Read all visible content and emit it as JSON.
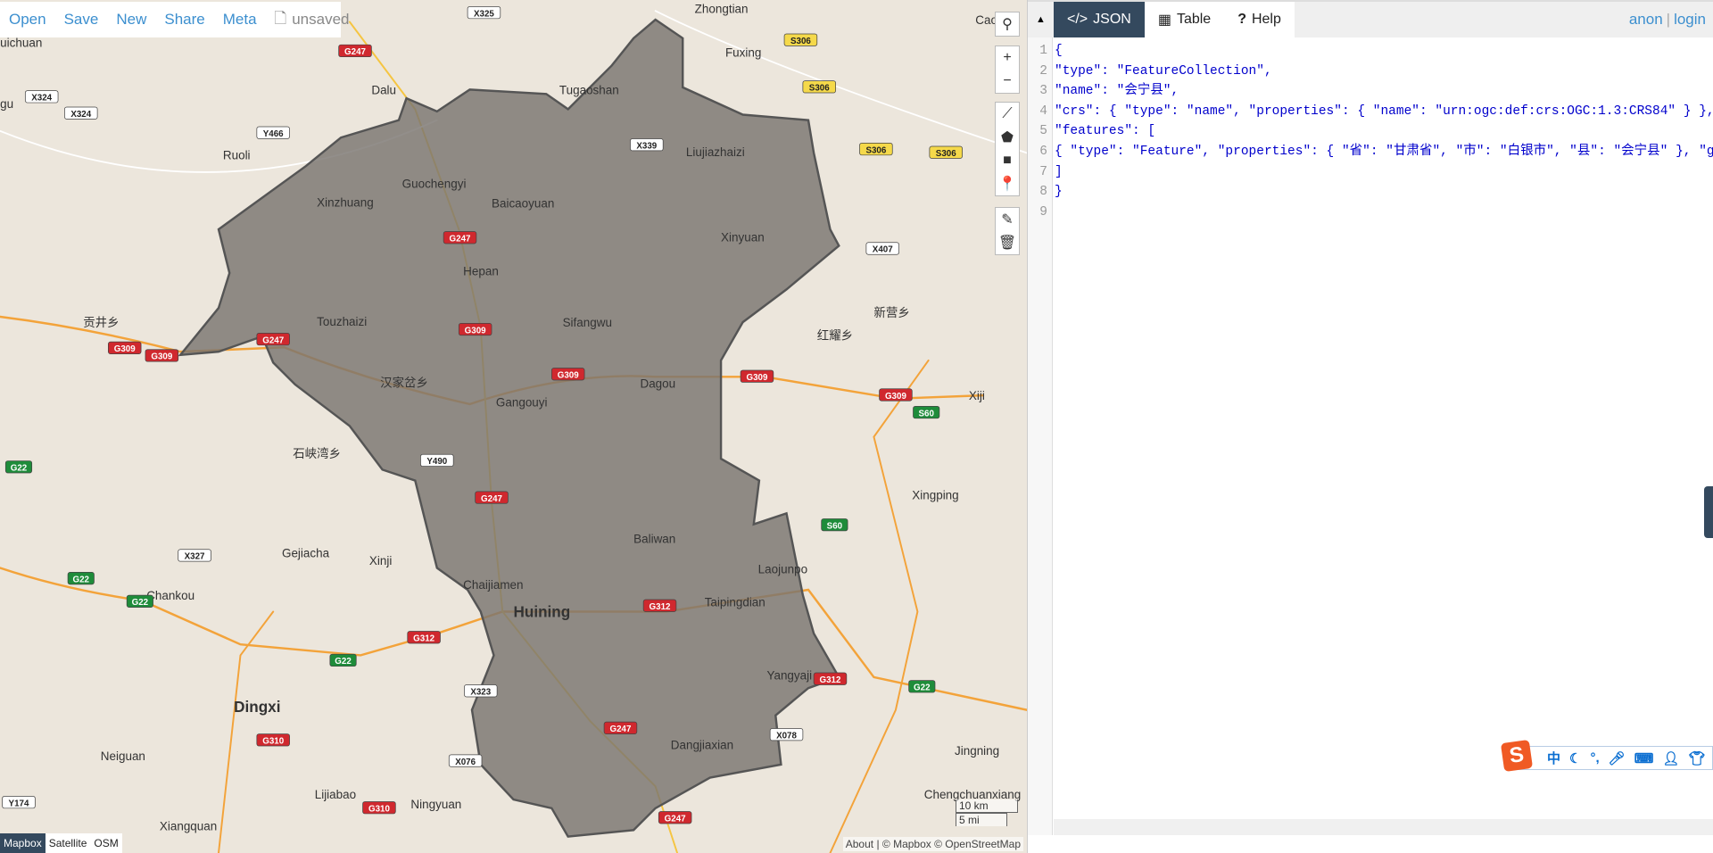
{
  "topbar": {
    "open": "Open",
    "save": "Save",
    "new": "New",
    "share": "Share",
    "meta": "Meta",
    "status": "unsaved"
  },
  "map": {
    "controls": [
      "search-icon",
      "zoom-in",
      "zoom-out",
      "draw-line-icon",
      "draw-polygon-icon",
      "draw-rectangle-icon",
      "draw-marker-icon",
      "edit-icon",
      "delete-icon"
    ],
    "zoom_in": "+",
    "zoom_out": "−",
    "places": [
      "Zhongtian",
      "Fuxing",
      "Caoj",
      "Tugaoshan",
      "Dalu",
      "Liujiazhaizi",
      "Ruoli",
      "Guochengyi",
      "Xinzhuang",
      "Baicaoyuan",
      "Xinyuan",
      "Hepan",
      "Touzhaizi",
      "Sifangwu",
      "贡井乡",
      "新营乡",
      "红耀乡",
      "汉家岔乡",
      "Dagou",
      "Gangouyi",
      "Xiji",
      "石峡湾乡",
      "Xingping",
      "Baliwan",
      "Gejiacha",
      "Xinji",
      "Chaijiamen",
      "Laojunpo",
      "Chankou",
      "Huining",
      "Taipingdian",
      "Yangyaji",
      "Dingxi",
      "Dangjiaxian",
      "Jingning",
      "Neiguan",
      "Lijiabao",
      "Ningyuan",
      "Chengchuanxiang",
      "Xiangquan",
      "uichuan",
      "gu"
    ],
    "shields": [
      "G247",
      "X325",
      "S306",
      "S306",
      "X324",
      "X324",
      "X339",
      "S306",
      "S306",
      "Y466",
      "G247",
      "X407",
      "G309",
      "G309",
      "G247",
      "G309",
      "G309",
      "G309",
      "G309",
      "S60",
      "Y490",
      "G22",
      "G247",
      "S60",
      "X327",
      "G22",
      "G22",
      "G312",
      "G312",
      "G22",
      "G22",
      "X323",
      "G312",
      "G310",
      "X076",
      "G247",
      "X078",
      "G310",
      "G247",
      "Y174"
    ],
    "layers": [
      "Mapbox",
      "Satellite",
      "OSM"
    ],
    "attribution": "About | © Mapbox © OpenStreetMap",
    "scale_km": "10 km",
    "scale_mi": "5 mi",
    "colors": {
      "polygon_fill": "#7a7570",
      "polygon_stroke": "#555555",
      "land": "#ece6dc",
      "road_red": "#d0282e",
      "road_yellow": "#f5d94a",
      "road_green": "#1e8c3a"
    }
  },
  "panel": {
    "tabs": [
      {
        "label": "JSON",
        "icon": "code-icon"
      },
      {
        "label": "Table",
        "icon": "table-icon"
      },
      {
        "label": "Help",
        "icon": "question-icon"
      }
    ],
    "user": "anon",
    "login": "login",
    "lines": [
      "{",
      "\"type\": \"FeatureCollection\",",
      "\"name\": \"会宁县\",",
      "\"crs\": { \"type\": \"name\", \"properties\": { \"name\": \"urn:ogc:def:crs:OGC:1.3:CRS84\" } },",
      "\"features\": [",
      "{ \"type\": \"Feature\", \"properties\": { \"省\": \"甘肃省\", \"市\": \"白银市\", \"县\": \"会宁县\" }, \"geometry\"",
      "]",
      "}",
      ""
    ],
    "line_numbers": [
      "1",
      "2",
      "3",
      "4",
      "5",
      "6",
      "7",
      "8",
      "9"
    ]
  },
  "ime": {
    "lang": "中"
  }
}
